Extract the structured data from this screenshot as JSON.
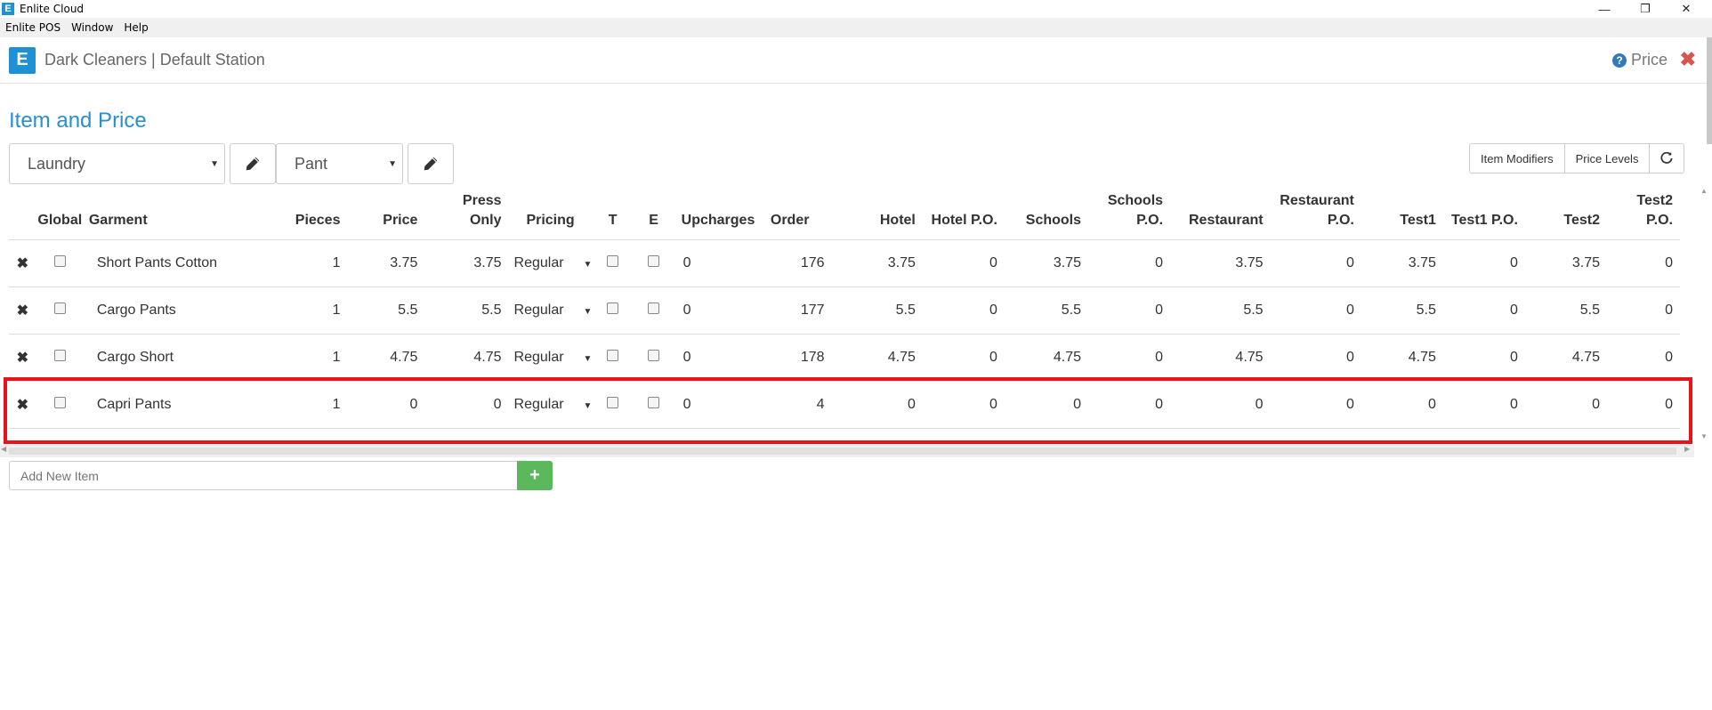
{
  "window": {
    "title": "Enlite Cloud",
    "controls": {
      "minimize": "—",
      "restore": "❐",
      "close": "✕"
    }
  },
  "menu": [
    "Enlite POS",
    "Window",
    "Help"
  ],
  "header": {
    "station": "Dark Cleaners | Default Station",
    "help_label": "Price"
  },
  "page_title": "Item and Price",
  "filters": {
    "category": "Laundry",
    "subcategory": "Pant"
  },
  "toolbar": {
    "item_modifiers": "Item Modifiers",
    "price_levels": "Price Levels"
  },
  "table": {
    "headers": {
      "global": "Global",
      "garment": "Garment",
      "pieces": "Pieces",
      "price": "Price",
      "press_only_1": "Press",
      "press_only_2": "Only",
      "pricing": "Pricing",
      "t": "T",
      "e": "E",
      "upcharges": "Upcharges",
      "order": "Order",
      "hotel": "Hotel",
      "hotel_po": "Hotel P.O.",
      "schools": "Schools",
      "schools_po_1": "Schools",
      "schools_po_2": "P.O.",
      "restaurant": "Restaurant",
      "restaurant_po_1": "Restaurant",
      "restaurant_po_2": "P.O.",
      "test1": "Test1",
      "test1_po": "Test1 P.O.",
      "test2": "Test2",
      "test2_po": "Test2 P.O."
    },
    "rows": [
      {
        "garment": "Short Pants Cotton",
        "pieces": "1",
        "price": "3.75",
        "press_only": "3.75",
        "pricing": "Regular",
        "upcharges": "0",
        "order": "176",
        "hotel": "3.75",
        "hotel_po": "0",
        "schools": "3.75",
        "schools_po": "0",
        "restaurant": "3.75",
        "restaurant_po": "0",
        "test1": "3.75",
        "test1_po": "0",
        "test2": "3.75",
        "test2_po": "0"
      },
      {
        "garment": "Cargo Pants",
        "pieces": "1",
        "price": "5.5",
        "press_only": "5.5",
        "pricing": "Regular",
        "upcharges": "0",
        "order": "177",
        "hotel": "5.5",
        "hotel_po": "0",
        "schools": "5.5",
        "schools_po": "0",
        "restaurant": "5.5",
        "restaurant_po": "0",
        "test1": "5.5",
        "test1_po": "0",
        "test2": "5.5",
        "test2_po": "0"
      },
      {
        "garment": "Cargo Short",
        "pieces": "1",
        "price": "4.75",
        "press_only": "4.75",
        "pricing": "Regular",
        "upcharges": "0",
        "order": "178",
        "hotel": "4.75",
        "hotel_po": "0",
        "schools": "4.75",
        "schools_po": "0",
        "restaurant": "4.75",
        "restaurant_po": "0",
        "test1": "4.75",
        "test1_po": "0",
        "test2": "4.75",
        "test2_po": "0"
      },
      {
        "garment": "Capri Pants",
        "pieces": "1",
        "price": "0",
        "press_only": "0",
        "pricing": "Regular",
        "upcharges": "0",
        "order": "4",
        "hotel": "0",
        "hotel_po": "0",
        "schools": "0",
        "schools_po": "0",
        "restaurant": "0",
        "restaurant_po": "0",
        "test1": "0",
        "test1_po": "0",
        "test2": "0",
        "test2_po": "0"
      }
    ]
  },
  "add_item": {
    "placeholder": "Add New Item"
  },
  "colors": {
    "accent": "#2a8ed0",
    "delete": "#d9534f",
    "add": "#5cb85c",
    "highlight": "#e8141a"
  }
}
